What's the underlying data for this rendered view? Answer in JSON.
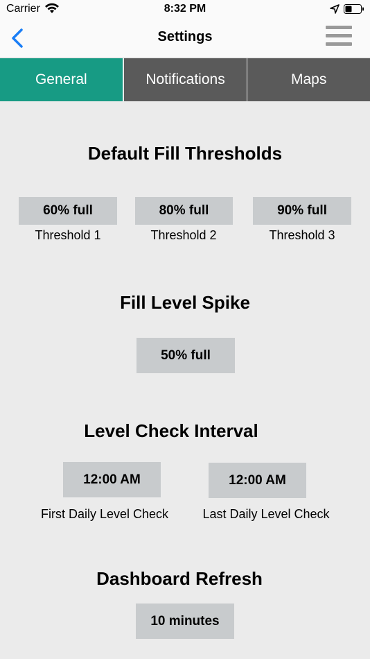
{
  "status": {
    "carrier": "Carrier",
    "time": "8:32 PM"
  },
  "nav": {
    "title": "Settings"
  },
  "tabs": [
    {
      "label": "General",
      "active": true
    },
    {
      "label": "Notifications",
      "active": false
    },
    {
      "label": "Maps",
      "active": false
    }
  ],
  "fill_thresholds": {
    "title": "Default Fill Thresholds",
    "items": [
      {
        "value": "60% full",
        "label": "Threshold 1"
      },
      {
        "value": "80% full",
        "label": "Threshold 2"
      },
      {
        "value": "90% full",
        "label": "Threshold 3"
      }
    ]
  },
  "spike": {
    "title": "Fill Level Spike",
    "value": "50% full"
  },
  "interval": {
    "title": "Level Check Interval",
    "items": [
      {
        "value": "12:00 AM",
        "label": "First Daily Level Check"
      },
      {
        "value": "12:00 AM",
        "label": "Last Daily Level Check"
      }
    ]
  },
  "refresh": {
    "title": "Dashboard Refresh",
    "value": "10 minutes"
  },
  "colors": {
    "accent": "#179b84",
    "tab_inactive": "#5a5a5a",
    "ios_blue": "#1a7ef6",
    "value_box": "#c8cbcd"
  }
}
